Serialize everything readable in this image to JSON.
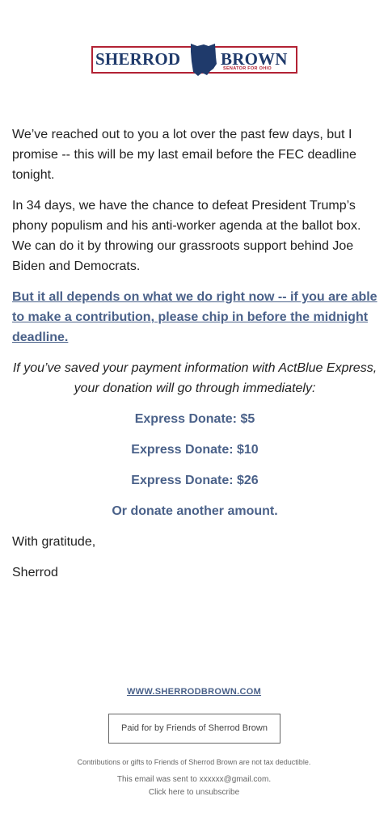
{
  "logo": {
    "first_name": "SHERROD",
    "last_name": "BROWN",
    "subtitle": "SENATOR FOR OHIO",
    "state_icon": "ohio-state-shape-icon",
    "colors": {
      "navy": "#1f3a6b",
      "red": "#b22234"
    }
  },
  "body": {
    "p1": "We’ve reached out to you a lot over the past few days, but I promise -- this will be my last email before the FEC deadline tonight.",
    "p2": "In 34 days, we have the chance to defeat President Trump’s phony populism and his anti-worker agenda at the ballot box. We can do it by throwing our grassroots support behind Joe Biden and Democrats.",
    "p3_link": "But it all depends on what we do right now -- if you are able to make a contribution, please chip in before the midnight deadline.",
    "p4": "If you’ve saved your payment information with ActBlue Express, your donation will go through immediately:",
    "donate_5": "Express Donate: $5",
    "donate_10": "Express Donate: $10",
    "donate_26": "Express Donate: $26",
    "donate_other": "Or donate another amount.",
    "closing": "With gratitude,",
    "signature": "Sherrod"
  },
  "footer": {
    "website": "WWW.SHERRODBROWN.COM",
    "paid_for": "Paid for by Friends of Sherrod Brown",
    "not_deductible": "Contributions or gifts to Friends of Sherrod Brown are not tax deductible.",
    "sent_to": "This email was sent to xxxxxx@gmail.com.",
    "unsubscribe": "Click here to unsubscribe"
  },
  "colors": {
    "link": "#4a6189",
    "text": "#222222",
    "muted": "#666666"
  }
}
